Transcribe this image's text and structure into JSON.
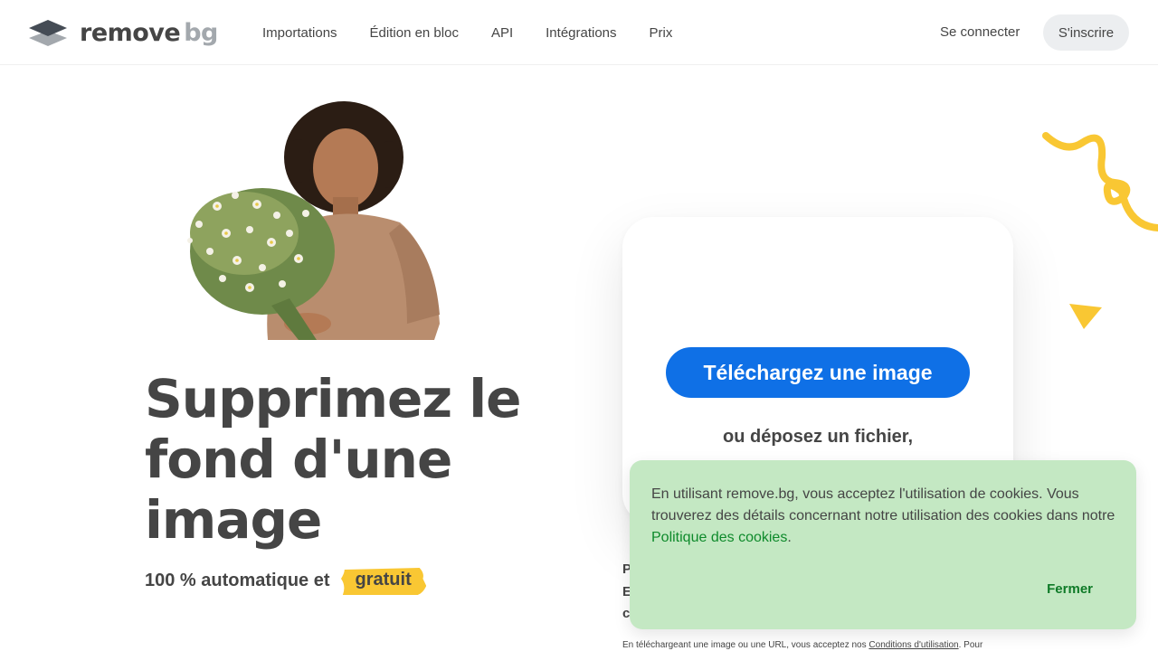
{
  "header": {
    "logo_main": "remove",
    "logo_suffix": "bg",
    "nav": [
      "Importations",
      "Édition en bloc",
      "API",
      "Intégrations",
      "Prix"
    ],
    "signin_label": "Se connecter",
    "signup_label": "S'inscrire"
  },
  "hero": {
    "title_lines": [
      "Supprimez le",
      "fond d'une",
      "image"
    ],
    "subtitle_prefix": "100 % automatique et",
    "subtitle_badge": "gratuit"
  },
  "upload": {
    "button_label": "Téléchargez une image",
    "drop_text": "ou déposez un fichier,",
    "peek_letters": [
      "P",
      "E",
      "c"
    ],
    "terms_prefix": "En téléchargeant une image ou une URL, vous acceptez nos",
    "terms_link": "Conditions d'utilisation",
    "terms_suffix": ". Pour"
  },
  "cookie": {
    "text": "En utilisant remove.bg, vous acceptez l'utilisation de cookies. Vous trouverez des détails concernant notre utilisation des cookies dans notre",
    "link": "Politique des cookies",
    "link_suffix": ".",
    "close_label": "Fermer"
  },
  "colors": {
    "primary": "#0f70e6",
    "text": "#454545",
    "accent_yellow": "#f9c733",
    "cookie_bg": "#c4e8c3",
    "cookie_link": "#0e8a2b"
  },
  "icons": {
    "logo": "layers-icon"
  }
}
